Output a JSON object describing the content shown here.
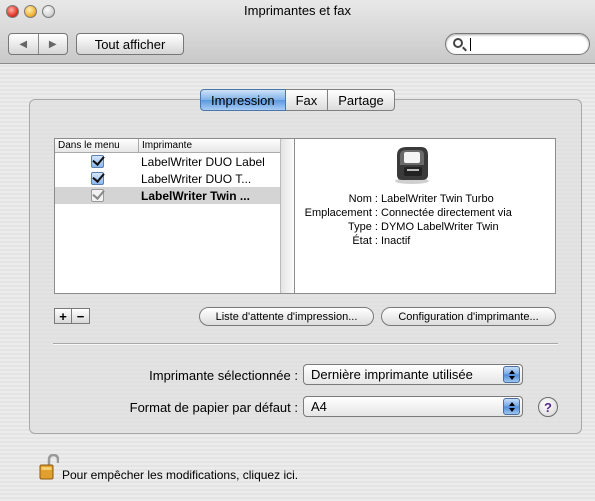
{
  "window": {
    "title": "Imprimantes et fax"
  },
  "toolbar": {
    "show_all_label": "Tout afficher",
    "search_value": ""
  },
  "tabs": [
    {
      "label": "Impression",
      "active": true
    },
    {
      "label": "Fax",
      "active": false
    },
    {
      "label": "Partage",
      "active": false
    }
  ],
  "printer_list": {
    "headers": {
      "in_menu": "Dans le menu",
      "printer": "Imprimante"
    },
    "rows": [
      {
        "name": "LabelWriter DUO Label",
        "in_menu": true,
        "selected": false
      },
      {
        "name": "LabelWriter DUO T...",
        "in_menu": true,
        "selected": false
      },
      {
        "name": "LabelWriter Twin ...",
        "in_menu": true,
        "selected": true
      }
    ]
  },
  "printer_info": {
    "icon": "label-printer-icon",
    "fields": [
      {
        "key": "Nom :",
        "value": "LabelWriter Twin Turbo"
      },
      {
        "key": "Emplacement :",
        "value": "Connectée directement via"
      },
      {
        "key": "Type :",
        "value": "DYMO LabelWriter Twin"
      },
      {
        "key": "État :",
        "value": "Inactif"
      }
    ]
  },
  "list_buttons": {
    "add": "+",
    "remove": "−"
  },
  "buttons": {
    "print_queue": "Liste d'attente d'impression...",
    "printer_setup": "Configuration d'imprimante..."
  },
  "settings": {
    "selected_printer_label": "Imprimante sélectionnée :",
    "selected_printer_value": "Dernière imprimante utilisée",
    "paper_size_label": "Format de papier par défaut :",
    "paper_size_value": "A4"
  },
  "help": {
    "label": "?"
  },
  "lock": {
    "text": "Pour empêcher les modifications, cliquez ici."
  },
  "colors": {
    "accent": "#5b98df",
    "selected_row": "#d4d4d4"
  }
}
